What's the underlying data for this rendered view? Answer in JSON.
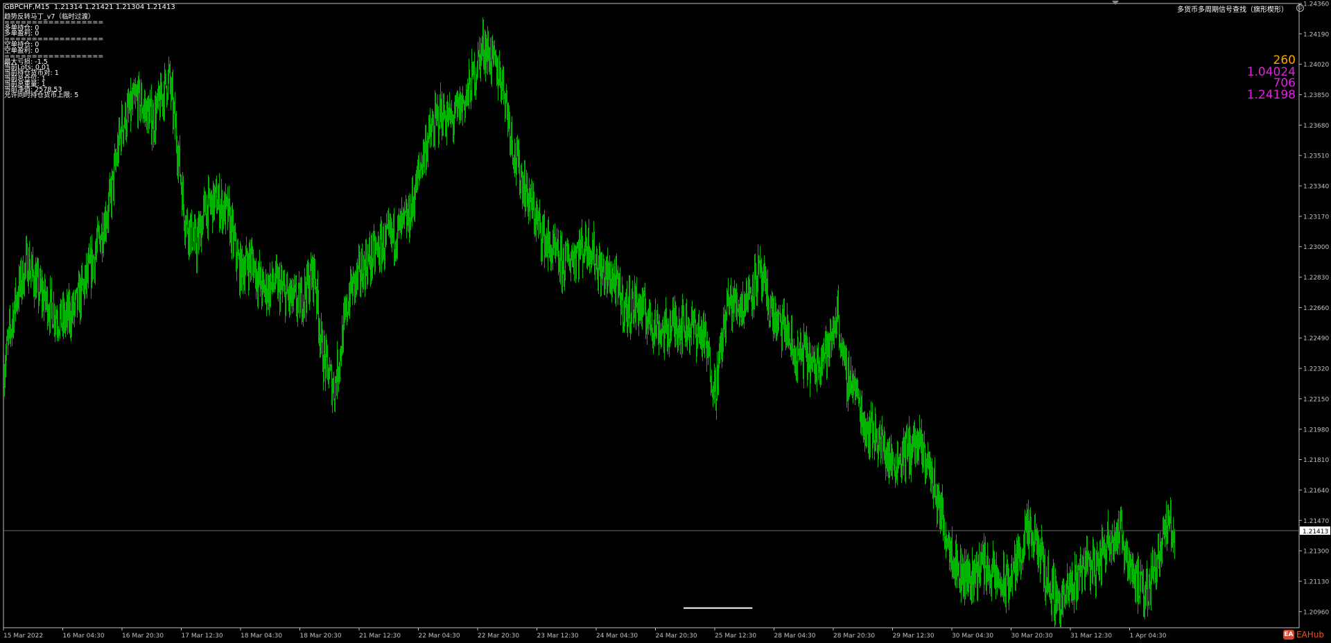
{
  "header": {
    "symbol_line": "GBPCHF,M15  1.21314 1.21421 1.21304 1.21413",
    "indicator_name": "多货币多周期信号查找（旗形楔形）",
    "smile_icon": "smile-icon"
  },
  "panel": {
    "lines": [
      "趋势反转马丁_v7（临时过渡）",
      "==================",
      "多单持仓: 0",
      "多单盈利: 0",
      "==================",
      "空单持仓: 0",
      "空单盈利: 0",
      "==================",
      "最大亏损: -1.5",
      "当前Lots: 0.01",
      "当前持仓货币对: 1",
      "当前总仓位: 1",
      "当前总重量: 1",
      "当前净值: 2578.53",
      "允许同时持仓货币上限: 5"
    ]
  },
  "stats": {
    "values": [
      {
        "text": "260",
        "color": "#ffa500"
      },
      {
        "text": "1.04024",
        "color": "#e61ee6"
      },
      {
        "text": "706",
        "color": "#e61ee6"
      },
      {
        "text": "1.24198",
        "color": "#e61ee6"
      }
    ]
  },
  "branding": {
    "logo_text": "EAHub",
    "logo_icon": "eahub-logo-icon"
  },
  "colors": {
    "background": "#000000",
    "candle": "#00b400",
    "axis": "#c0c0c0",
    "current_line": "#6a6a6a"
  },
  "chart_data": {
    "type": "line",
    "symbol": "GBPCHF",
    "timeframe": "M15",
    "ylim": [
      1.2087,
      1.2436
    ],
    "y_ticks": [
      "1.24360",
      "1.24190",
      "1.24020",
      "1.23850",
      "1.23680",
      "1.23510",
      "1.23340",
      "1.23170",
      "1.23000",
      "1.22830",
      "1.22660",
      "1.22490",
      "1.22320",
      "1.22150",
      "1.21980",
      "1.21810",
      "1.21640",
      "1.21470",
      "1.21300",
      "1.21130",
      "1.20960"
    ],
    "x_ticks": [
      "15 Mar 2022",
      "16 Mar 04:30",
      "16 Mar 20:30",
      "17 Mar 12:30",
      "18 Mar 04:30",
      "18 Mar 20:30",
      "21 Mar 12:30",
      "22 Mar 04:30",
      "22 Mar 20:30",
      "23 Mar 12:30",
      "24 Mar 04:30",
      "24 Mar 20:30",
      "25 Mar 12:30",
      "28 Mar 04:30",
      "28 Mar 20:30",
      "29 Mar 12:30",
      "30 Mar 04:30",
      "30 Mar 20:30",
      "31 Mar 12:30",
      "1 Apr 04:30"
    ],
    "current_price": 1.21413,
    "current_price_label": "1.21413",
    "support_level": 1.2098,
    "support_range": [
      18.0,
      19.0
    ],
    "grid": false,
    "price_path": [
      [
        0,
        1.2232
      ],
      [
        0.3,
        1.227
      ],
      [
        0.6,
        1.2292
      ],
      [
        0.9,
        1.2275
      ],
      [
        1.2,
        1.2266
      ],
      [
        1.5,
        1.2258
      ],
      [
        1.8,
        1.2265
      ],
      [
        2.2,
        1.2287
      ],
      [
        2.7,
        1.2325
      ],
      [
        3.0,
        1.2368
      ],
      [
        3.4,
        1.2383
      ],
      [
        3.8,
        1.237
      ],
      [
        4.2,
        1.2395
      ],
      [
        4.4,
        1.236
      ],
      [
        4.6,
        1.2317
      ],
      [
        4.9,
        1.23
      ],
      [
        5.1,
        1.232
      ],
      [
        5.4,
        1.2326
      ],
      [
        5.7,
        1.2318
      ],
      [
        6.0,
        1.2287
      ],
      [
        6.3,
        1.2293
      ],
      [
        6.6,
        1.2275
      ],
      [
        6.9,
        1.228
      ],
      [
        7.2,
        1.2272
      ],
      [
        7.5,
        1.2268
      ],
      [
        7.9,
        1.2287
      ],
      [
        8.1,
        1.224
      ],
      [
        8.4,
        1.222
      ],
      [
        8.8,
        1.2275
      ],
      [
        9.2,
        1.229
      ],
      [
        9.6,
        1.23
      ],
      [
        10.0,
        1.2308
      ],
      [
        10.3,
        1.2315
      ],
      [
        10.7,
        1.2355
      ],
      [
        11.1,
        1.2375
      ],
      [
        11.4,
        1.237
      ],
      [
        11.8,
        1.2385
      ],
      [
        12.2,
        1.2413
      ],
      [
        12.7,
        1.2392
      ],
      [
        13.0,
        1.235
      ],
      [
        13.3,
        1.233
      ],
      [
        13.6,
        1.2312
      ],
      [
        13.9,
        1.2298
      ],
      [
        14.2,
        1.229
      ],
      [
        14.6,
        1.2298
      ],
      [
        14.9,
        1.2302
      ],
      [
        15.2,
        1.2285
      ],
      [
        15.5,
        1.2282
      ],
      [
        15.8,
        1.2265
      ],
      [
        16.1,
        1.2268
      ],
      [
        16.4,
        1.226
      ],
      [
        16.8,
        1.2252
      ],
      [
        17.1,
        1.2258
      ],
      [
        17.5,
        1.2255
      ],
      [
        17.8,
        1.225
      ],
      [
        18.1,
        1.222
      ],
      [
        18.4,
        1.2268
      ],
      [
        18.8,
        1.2268
      ],
      [
        19.2,
        1.2285
      ],
      [
        19.5,
        1.2265
      ],
      [
        19.7,
        1.2255
      ],
      [
        19.9,
        1.2255
      ],
      [
        20.1,
        1.2238
      ],
      [
        20.4,
        1.224
      ],
      [
        20.6,
        1.223
      ],
      [
        20.8,
        1.2242
      ],
      [
        21.0,
        1.2242
      ],
      [
        21.2,
        1.2265
      ],
      [
        21.4,
        1.2228
      ],
      [
        21.6,
        1.2225
      ],
      [
        21.9,
        1.22
      ],
      [
        22.2,
        1.2195
      ],
      [
        22.6,
        1.2178
      ],
      [
        22.9,
        1.2185
      ],
      [
        23.2,
        1.219
      ],
      [
        23.5,
        1.218
      ],
      [
        23.7,
        1.2162
      ],
      [
        24.0,
        1.2138
      ],
      [
        24.3,
        1.2118
      ],
      [
        24.6,
        1.2115
      ],
      [
        24.9,
        1.2124
      ],
      [
        25.2,
        1.2115
      ],
      [
        25.5,
        1.211
      ],
      [
        25.8,
        1.2125
      ],
      [
        26.0,
        1.214
      ],
      [
        26.3,
        1.2132
      ],
      [
        26.6,
        1.211
      ],
      [
        26.9,
        1.2101
      ],
      [
        27.2,
        1.2111
      ],
      [
        27.5,
        1.2125
      ],
      [
        27.8,
        1.212
      ],
      [
        28.1,
        1.2138
      ],
      [
        28.4,
        1.214
      ],
      [
        28.7,
        1.212
      ],
      [
        29.0,
        1.2103
      ],
      [
        29.3,
        1.2125
      ],
      [
        29.6,
        1.2145
      ],
      [
        29.8,
        1.2138
      ]
    ]
  }
}
